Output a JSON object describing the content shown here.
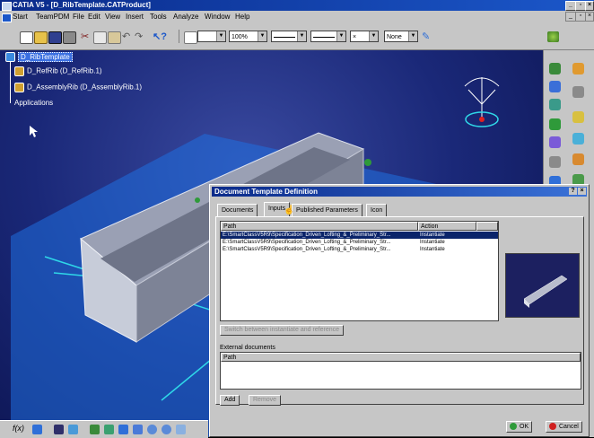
{
  "app": {
    "title": "CATIA V5 - [D_RibTemplate.CATProduct]",
    "menus": [
      "Start",
      "TeamPDM",
      "File",
      "Edit",
      "View",
      "Insert",
      "Tools",
      "Analyze",
      "Window",
      "Help"
    ]
  },
  "toolbar": {
    "zoom_value": "100%",
    "linetype_value": "None"
  },
  "tree": {
    "root": "D_RibTemplate",
    "items": [
      "D_RefRib (D_RefRib.1)",
      "D_AssemblyRib (D_AssemblyRib.1)"
    ],
    "applications": "Applications"
  },
  "dialog": {
    "title": "Document Template Definition",
    "tabs": [
      "Documents",
      "Inputs",
      "Published Parameters",
      "Icon"
    ],
    "columns": {
      "path": "Path",
      "action": "Action"
    },
    "rows": [
      {
        "path": "E:\\SmartClassV5R9\\Specification_Driven_Lofting_&_Preliminary_Str...",
        "action": "Instantiate"
      },
      {
        "path": "E:\\SmartClassV5R9\\Specification_Driven_Lofting_&_Preliminary_Str...",
        "action": "Instantiate"
      },
      {
        "path": "E:\\SmartClassV5R9\\Specification_Driven_Lofting_&_Preliminary_Str...",
        "action": "Instantiate"
      }
    ],
    "switch_button": "Switch between instantiate and reference",
    "external_label": "External documents",
    "external_path_header": "Path",
    "add_button": "Add",
    "remove_button": "Remove",
    "ok_button": "OK",
    "cancel_button": "Cancel"
  },
  "colors": {
    "title_blue": "#0a2a8a",
    "selection": "#0a246a",
    "viewport_blue": "#1a2878",
    "plane_blue": "#1f6fe0",
    "cyan_line": "#2fd8e8"
  }
}
